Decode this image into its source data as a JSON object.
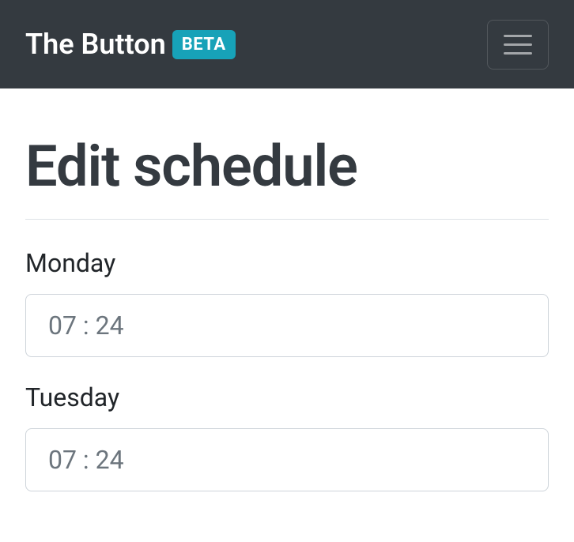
{
  "navbar": {
    "brand_text": "The Button",
    "beta_label": "BETA"
  },
  "page": {
    "title": "Edit schedule"
  },
  "schedule": {
    "days": [
      {
        "label": "Monday",
        "time": "07 : 24"
      },
      {
        "label": "Tuesday",
        "time": "07 : 24"
      }
    ]
  }
}
